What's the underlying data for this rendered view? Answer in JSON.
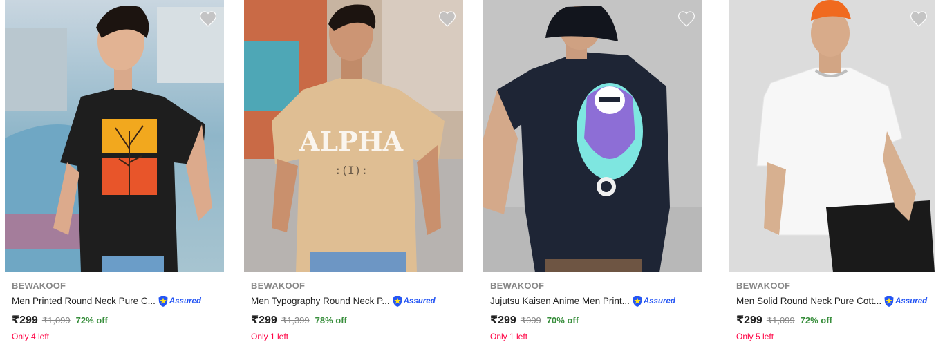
{
  "products": [
    {
      "brand": "BEWAKOOF",
      "title": "Men Printed Round Neck Pure C...",
      "assured_label": "Assured",
      "price": "₹299",
      "mrp": "₹1,099",
      "discount": "72% off",
      "stock": "Only 4 left",
      "image_icon": "model-black-printed-tshirt",
      "wishlist_icon": "heart-icon"
    },
    {
      "brand": "BEWAKOOF",
      "title": "Men Typography Round Neck P...",
      "assured_label": "Assured",
      "price": "₹299",
      "mrp": "₹1,399",
      "discount": "78% off",
      "stock": "Only 1 left",
      "image_icon": "model-beige-typography-tshirt",
      "wishlist_icon": "heart-icon"
    },
    {
      "brand": "BEWAKOOF",
      "title": "Jujutsu Kaisen Anime Men Print...",
      "assured_label": "Assured",
      "price": "₹299",
      "mrp": "₹999",
      "discount": "70% off",
      "stock": "Only 1 left",
      "image_icon": "model-navy-anime-tshirt",
      "wishlist_icon": "heart-icon"
    },
    {
      "brand": "BEWAKOOF",
      "title": "Men Solid Round Neck Pure Cott...",
      "assured_label": "Assured",
      "price": "₹299",
      "mrp": "₹1,099",
      "discount": "72% off",
      "stock": "Only 5 left",
      "image_icon": "model-white-solid-tshirt",
      "wishlist_icon": "heart-icon"
    }
  ],
  "colors": {
    "brand_grey": "#878787",
    "discount_green": "#388e3c",
    "stock_red": "#ff0042",
    "assured_blue": "#2455f4"
  }
}
